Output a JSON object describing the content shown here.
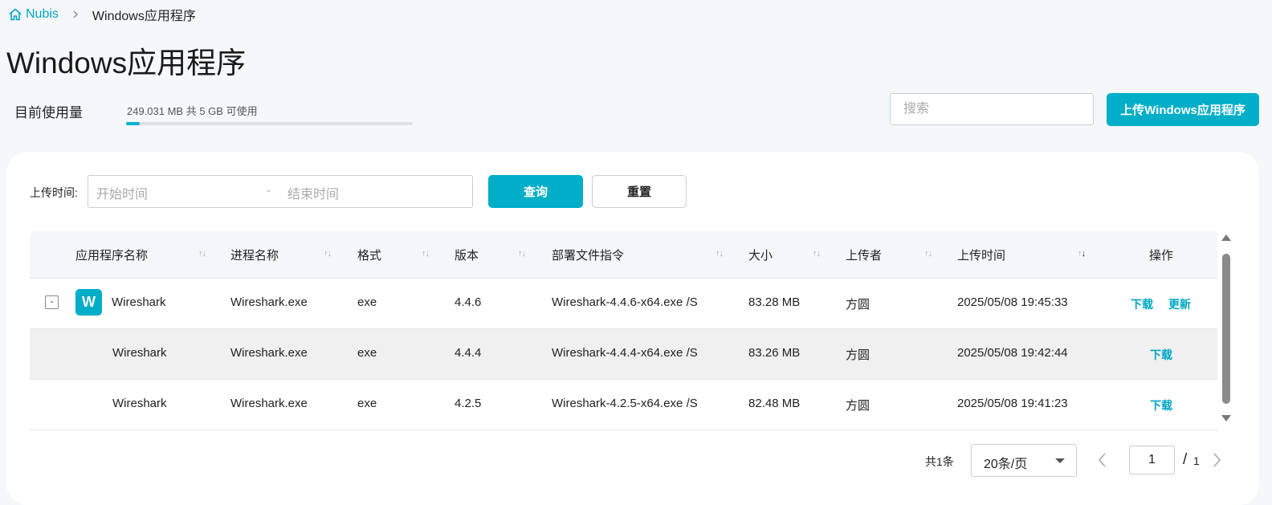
{
  "breadcrumb": {
    "home": "Nubis",
    "current": "Windows应用程序"
  },
  "page_title": "Windows应用程序",
  "usage": {
    "label": "目前使用量",
    "text": "249.031 MB 共 5 GB 可使用",
    "percent": 4.9
  },
  "search": {
    "placeholder": "搜索"
  },
  "upload_button": "上传Windows应用程序",
  "filter": {
    "label": "上传时间:",
    "start_placeholder": "开始时间",
    "separator": "-",
    "end_placeholder": "结束时间",
    "query_button": "查询",
    "reset_button": "重置"
  },
  "table": {
    "columns": [
      "应用程序名称",
      "进程名称",
      "格式",
      "版本",
      "部署文件指令",
      "大小",
      "上传者",
      "上传时间",
      "操作"
    ],
    "rows": [
      {
        "icon_letter": "W",
        "collapse": "-",
        "name": "Wireshark",
        "process": "Wireshark.exe",
        "format": "exe",
        "version": "4.4.6",
        "command": "Wireshark-4.4.6-x64.exe /S",
        "size": "83.28 MB",
        "uploader": "方圆",
        "time": "2025/05/08 19:45:33",
        "actions": [
          "下载",
          "更新"
        ]
      },
      {
        "name": "Wireshark",
        "process": "Wireshark.exe",
        "format": "exe",
        "version": "4.4.4",
        "command": "Wireshark-4.4.4-x64.exe /S",
        "size": "83.26 MB",
        "uploader": "方圆",
        "time": "2025/05/08 19:42:44",
        "actions": [
          "下载"
        ]
      },
      {
        "name": "Wireshark",
        "process": "Wireshark.exe",
        "format": "exe",
        "version": "4.2.5",
        "command": "Wireshark-4.2.5-x64.exe /S",
        "size": "82.48 MB",
        "uploader": "方圆",
        "time": "2025/05/08 19:41:23",
        "actions": [
          "下载"
        ]
      }
    ]
  },
  "pagination": {
    "total": "共1条",
    "page_size": "20条/页",
    "current": "1",
    "slash": "/",
    "pages": "1"
  },
  "colors": {
    "accent": "#00aec8"
  },
  "icons": [
    "home-icon",
    "chevron-right-icon",
    "sort-icon",
    "chevron-down-icon",
    "chevron-left-icon"
  ]
}
